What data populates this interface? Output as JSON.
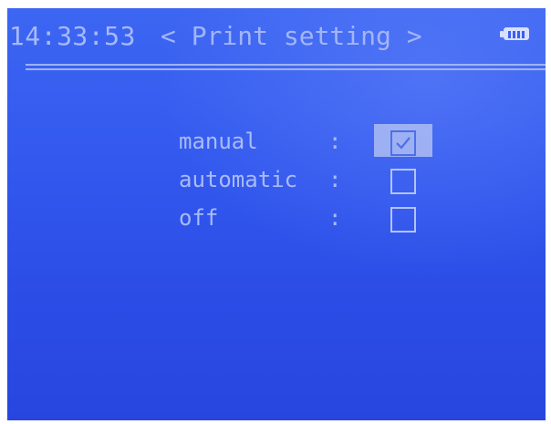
{
  "status_bar": {
    "time": "14:33:53",
    "title": "< Print setting >",
    "battery_icon": "battery-full-icon"
  },
  "print_setting": {
    "options": [
      {
        "label": "manual",
        "separator": ":",
        "checked": true
      },
      {
        "label": "automatic",
        "separator": ":",
        "checked": false
      },
      {
        "label": "off",
        "separator": ":",
        "checked": false
      }
    ]
  },
  "colors": {
    "screen_background": "#3258ee",
    "text": "#a9bbf9",
    "highlight": "#aebdf3"
  }
}
